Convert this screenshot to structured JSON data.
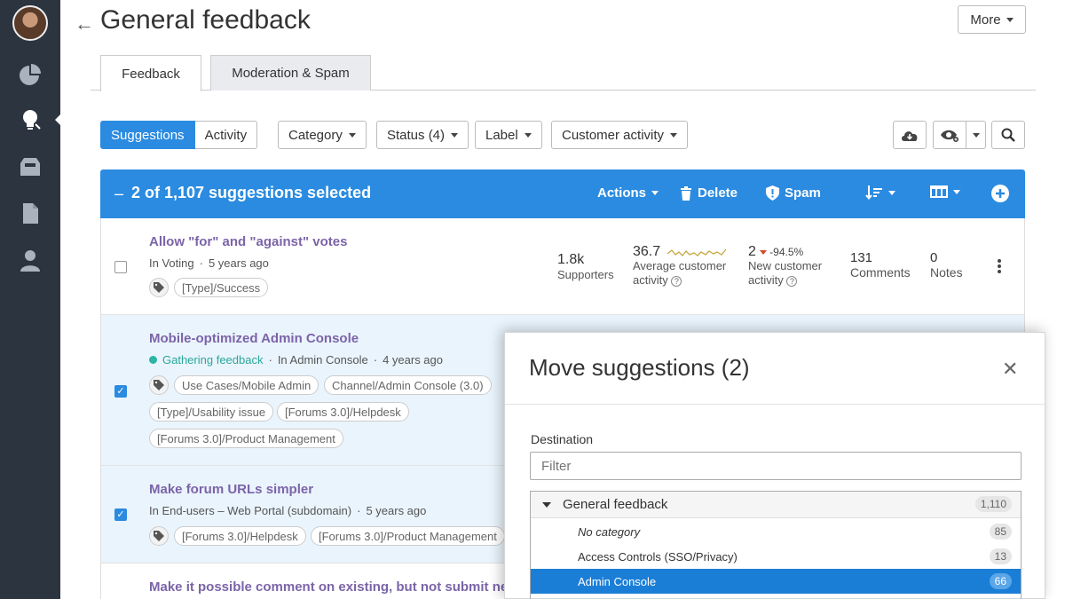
{
  "page": {
    "title": "General feedback",
    "more_label": "More"
  },
  "tabs": [
    {
      "label": "Feedback"
    },
    {
      "label": "Moderation & Spam"
    }
  ],
  "toolbar": {
    "view_toggle": [
      "Suggestions",
      "Activity"
    ],
    "filters": [
      "Category",
      "Status (4)",
      "Label",
      "Customer activity"
    ]
  },
  "selection_bar": {
    "count_text": "2 of 1,107 suggestions selected",
    "actions_label": "Actions",
    "delete_label": "Delete",
    "spam_label": "Spam"
  },
  "suggestions": [
    {
      "title": "Allow \"for\" and \"against\" votes",
      "status": "",
      "forum": "In Voting",
      "age": "5 years ago",
      "checked": false,
      "tags": [
        "[Type]/Success"
      ],
      "supporters": "1.8k",
      "supporters_label": "Supporters",
      "avg_activity": "36.7",
      "avg_activity_label": "Average customer",
      "avg_activity_label2": "activity",
      "new_activity": "2",
      "new_activity_change": "-94.5%",
      "new_activity_label": "New customer",
      "new_activity_label2": "activity",
      "comments": "131",
      "comments_label": "Comments",
      "notes": "0",
      "notes_label": "Notes"
    },
    {
      "title": "Mobile-optimized Admin Console",
      "status": "Gathering feedback",
      "forum": "In Admin Console",
      "age": "4 years ago",
      "checked": true,
      "tags": [
        "Use Cases/Mobile Admin",
        "Channel/Admin Console (3.0)",
        "[Type]/Usability issue",
        "[Forums 3.0]/Helpdesk",
        "[Forums 3.0]/Product Management"
      ]
    },
    {
      "title": "Make forum URLs simpler",
      "status": "",
      "forum": "In End-users – Web Portal (subdomain)",
      "age": "5 years ago",
      "checked": true,
      "tags": [
        "[Forums 3.0]/Helpdesk",
        "[Forums 3.0]/Product Management"
      ]
    },
    {
      "title": "Make it possible comment on existing, but not submit new"
    }
  ],
  "modal": {
    "title": "Move suggestions (2)",
    "destination_label": "Destination",
    "filter_placeholder": "Filter",
    "tree": [
      {
        "label": "General feedback",
        "count": "1,110"
      },
      {
        "label": "No category",
        "count": "85"
      },
      {
        "label": "Access Controls (SSO/Privacy)",
        "count": "13"
      },
      {
        "label": "Admin Console",
        "count": "66"
      }
    ]
  },
  "colors": {
    "primary": "#2b8be0",
    "sidebar": "#2c3440",
    "title_link": "#7b64a8",
    "status_teal": "#2aa79b",
    "selected_row": "#eaf4fc",
    "decline_red": "#d9452b",
    "sparkline": "#c8a842"
  },
  "icons": {
    "sidebar": [
      "avatar",
      "pie-chart-icon",
      "lightbulb-icon",
      "inbox-icon",
      "document-icon",
      "user-icon"
    ],
    "toolbar": [
      "cloud-download-icon",
      "eye-icon",
      "search-icon"
    ],
    "selection_bar": [
      "trash-icon",
      "shield-icon",
      "sort-icon",
      "columns-icon",
      "plus-circle-icon"
    ]
  }
}
